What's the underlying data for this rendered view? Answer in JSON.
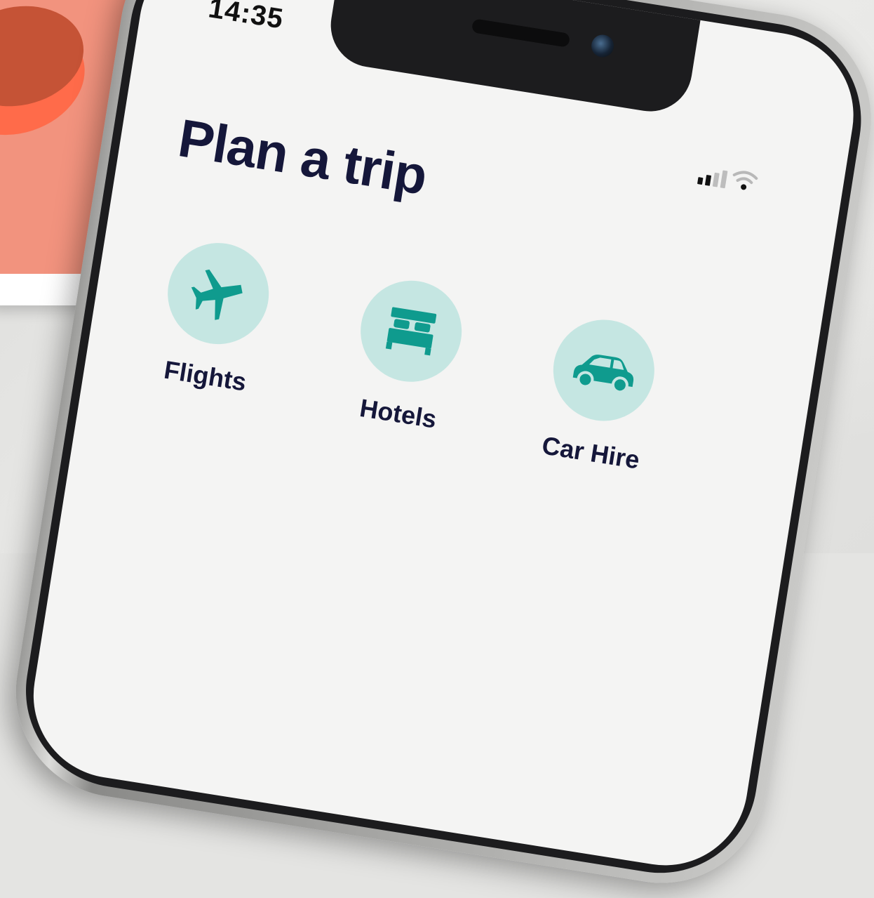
{
  "status_bar": {
    "time": "14:35",
    "signal_icon": "cellular-signal-icon",
    "wifi_icon": "wifi-icon"
  },
  "page": {
    "title": "Plan a trip"
  },
  "services": [
    {
      "label": "Flights",
      "icon": "airplane-icon"
    },
    {
      "label": "Hotels",
      "icon": "bed-icon"
    },
    {
      "label": "Car Hire",
      "icon": "car-icon"
    }
  ],
  "colors": {
    "accent_teal": "#0f9b8e",
    "icon_circle": "#c5e6e2",
    "title_navy": "#15173a",
    "screen_bg": "#f4f4f3"
  }
}
